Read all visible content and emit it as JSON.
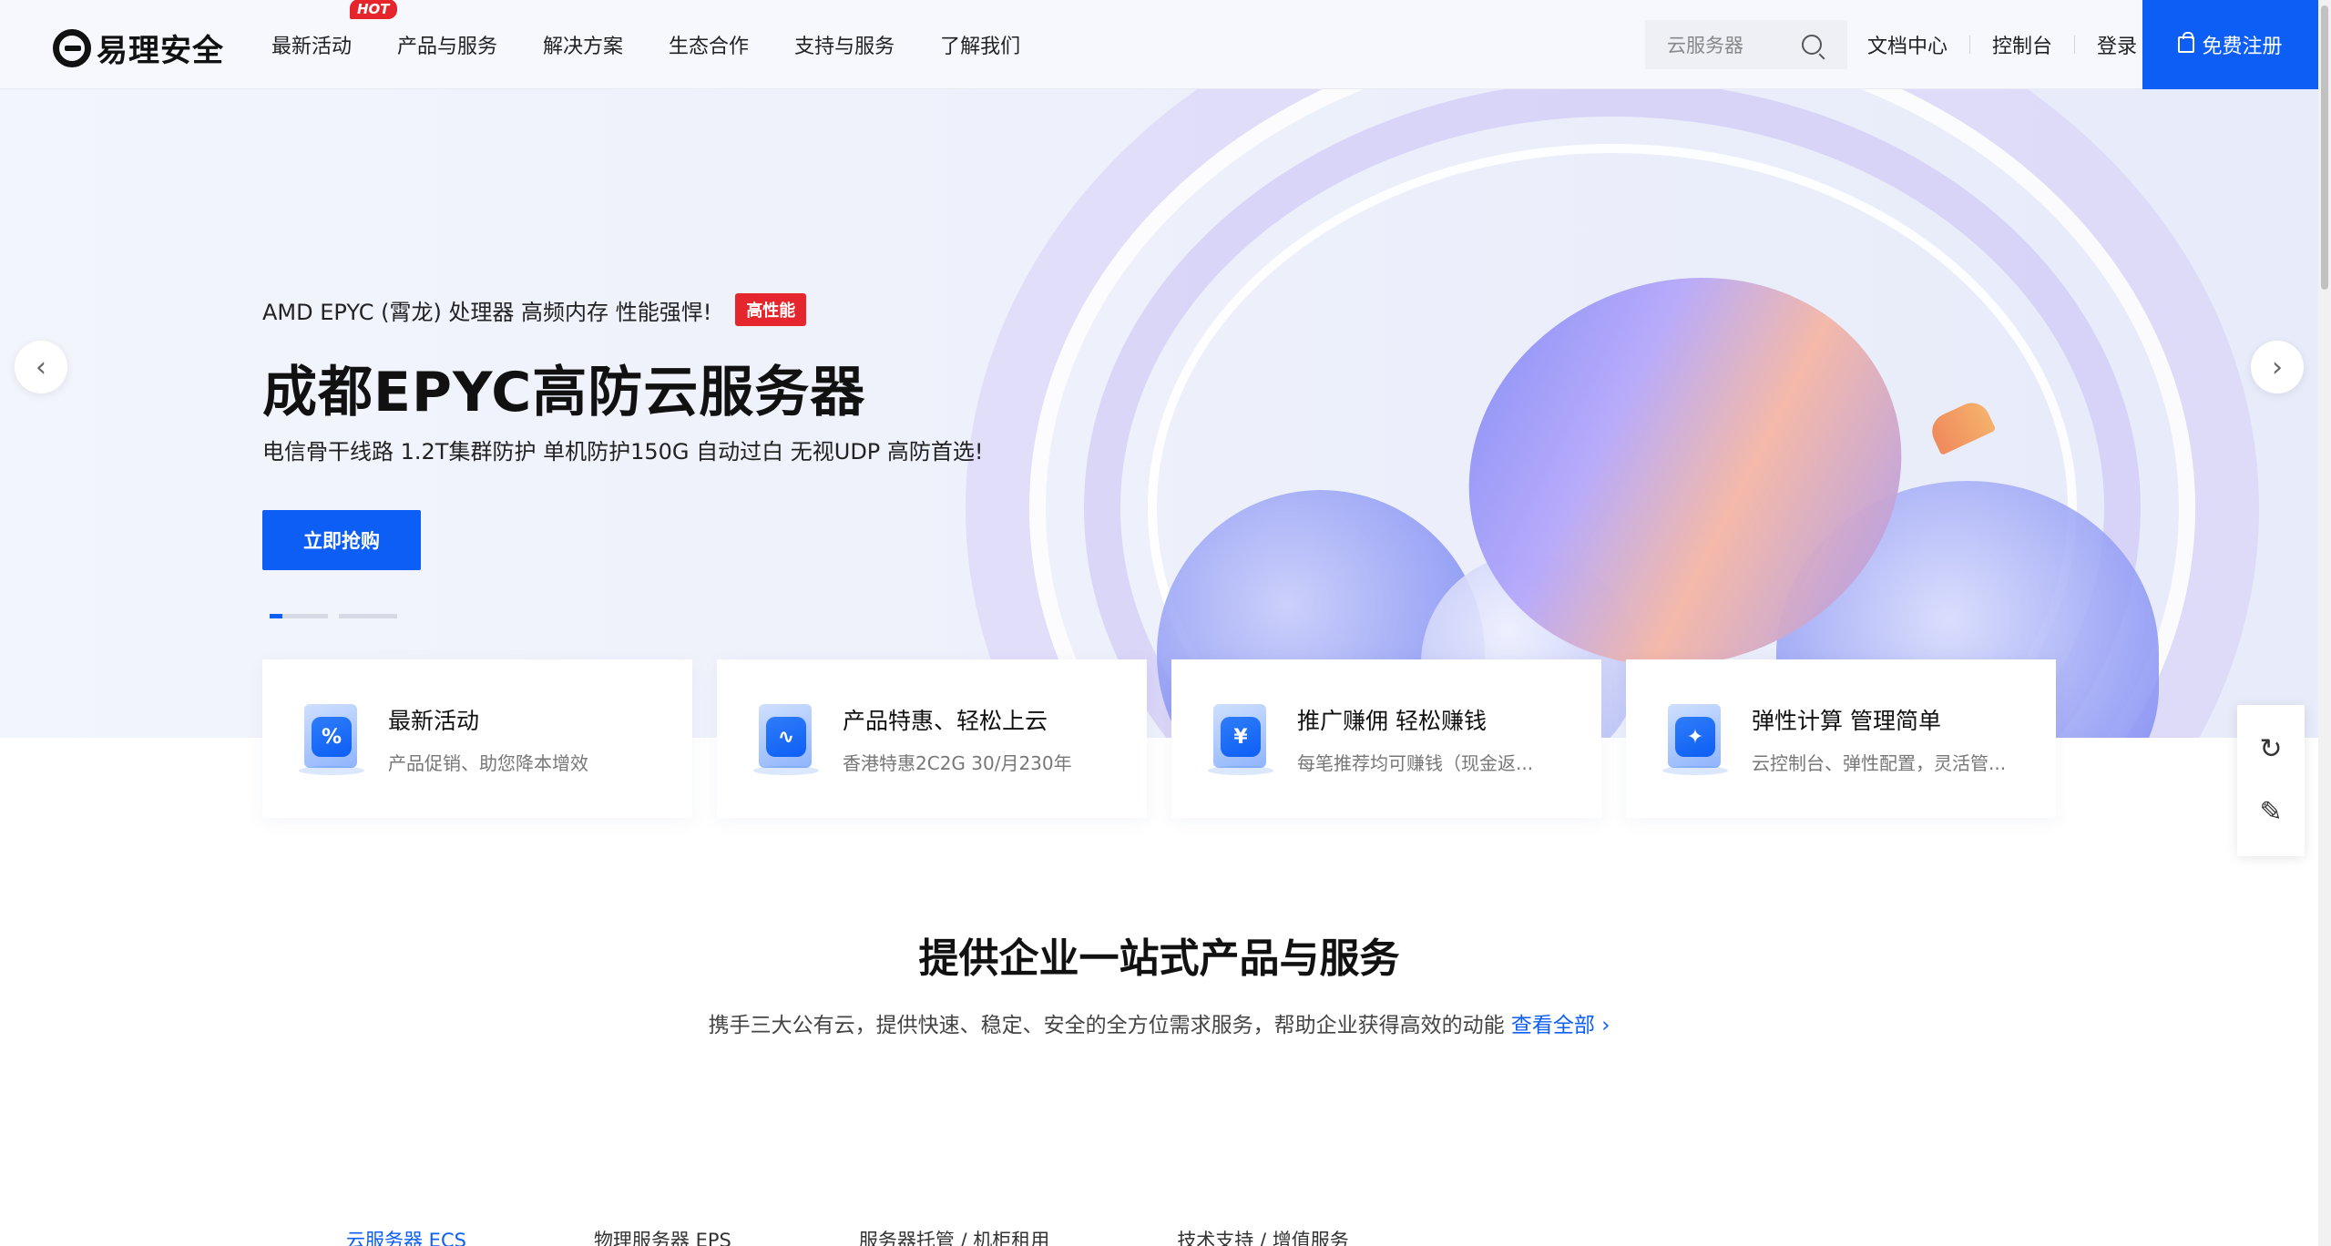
{
  "header": {
    "logo_text": "易理安全",
    "hot_badge": "HOT",
    "nav": [
      "最新活动",
      "产品与服务",
      "解决方案",
      "生态合作",
      "支持与服务",
      "了解我们"
    ],
    "search_placeholder": "云服务器",
    "links": [
      "文档中心",
      "控制台",
      "登录"
    ],
    "register": "免费注册"
  },
  "hero": {
    "subtitle": "AMD EPYC (霄龙) 处理器 高频内存 性能强悍!",
    "badge": "高性能",
    "title": "成都EPYC高防云服务器",
    "description": "电信骨干线路 1.2T集群防护 单机防护150G 自动过白 无视UDP 高防首选!",
    "cta": "立即抢购",
    "prev_arrow": "‹",
    "next_arrow": "›"
  },
  "cards": [
    {
      "title": "最新活动",
      "desc": "产品促销、助您降本增效",
      "glyph": "%"
    },
    {
      "title": "产品特惠、轻松上云",
      "desc": "香港特惠2C2G 30/月230年",
      "glyph": "∿"
    },
    {
      "title": "推广赚佣 轻松赚钱",
      "desc": "每笔推荐均可赚钱（现金返...",
      "glyph": "¥"
    },
    {
      "title": "弹性计算 管理简单",
      "desc": "云控制台、弹性配置，灵活管...",
      "glyph": "✦"
    }
  ],
  "float_tools": {
    "service": "↻",
    "feedback": "✎"
  },
  "section": {
    "title": "提供企业一站式产品与服务",
    "desc": "携手三大公有云，提供快速、稳定、安全的全方位需求服务，帮助企业获得高效的动能",
    "link": "查看全部",
    "tabs": [
      "云服务器 ECS",
      "物理服务器 EPS",
      "服务器托管 / 机柜租用",
      "技术支持 / 增值服务"
    ]
  },
  "colors": {
    "accent": "#0d5ef4",
    "badge_red": "#e5272d"
  }
}
